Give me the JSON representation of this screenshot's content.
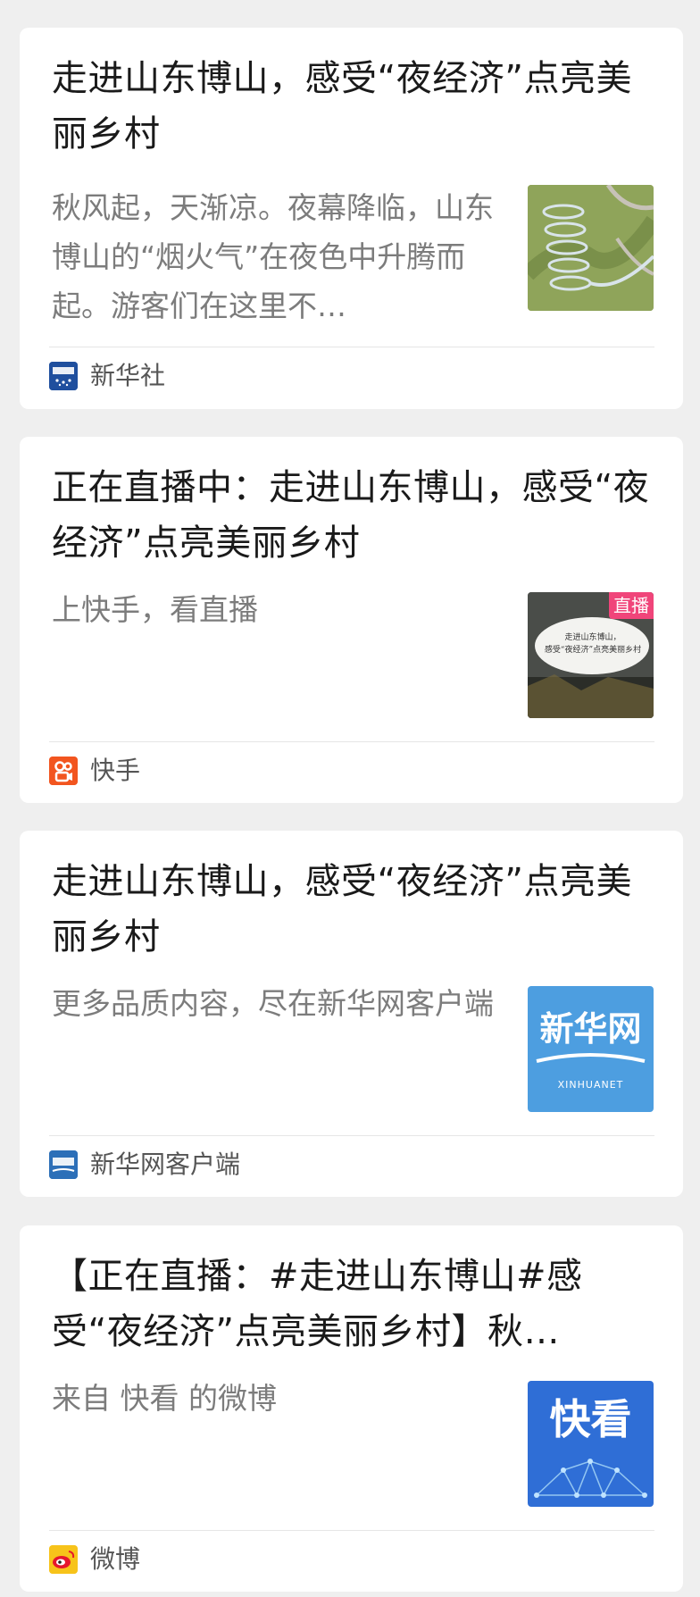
{
  "cards": [
    {
      "title": "走进山东博山，感受“夜经济”点亮美丽乡村",
      "summary": "秋风起，天渐凉。夜幕降临，山东博山的“烟火气”在夜色中升腾而起。游客们在这里不…",
      "source": "新华社",
      "source_icon": "xinhua-agency-icon",
      "thumb": "spiral-road-photo",
      "thumb_badge": ""
    },
    {
      "title": "正在直播中：走进山东博山，感受“夜经济”点亮美丽乡村",
      "summary": "上快手，看直播",
      "source": "快手",
      "source_icon": "kuaishou-icon",
      "thumb": "live-stream-thumbnail",
      "thumb_badge": "直播",
      "thumb_caption_line1": "走进山东博山，",
      "thumb_caption_line2": "感受“夜经济”点亮美丽乡村"
    },
    {
      "title": "走进山东博山，感受“夜经济”点亮美丽乡村",
      "summary": "更多品质内容，尽在新华网客户端",
      "source": "新华网客户端",
      "source_icon": "xinhuanet-icon",
      "thumb": "xinhuanet-logo",
      "thumb_logo_cn": "新华网",
      "thumb_logo_en": "XINHUANET"
    },
    {
      "title": "【正在直播：#走进山东博山#感受“夜经济”点亮美丽乡村】秋…",
      "summary": "来自 快看 的微博",
      "source": "微博",
      "source_icon": "weibo-icon",
      "thumb": "kuaikan-logo",
      "thumb_logo_cn": "快看"
    }
  ],
  "colors": {
    "page_bg": "#efefef",
    "card_bg": "#ffffff",
    "title": "#1a1a1a",
    "summary": "#7c7c7c",
    "source_text": "#555555",
    "xinhua_blue": "#1f4f9e",
    "kuaishou_orange": "#f2551f",
    "weibo_yellow": "#f7c31a",
    "live_badge_pink": "#f0457a"
  }
}
